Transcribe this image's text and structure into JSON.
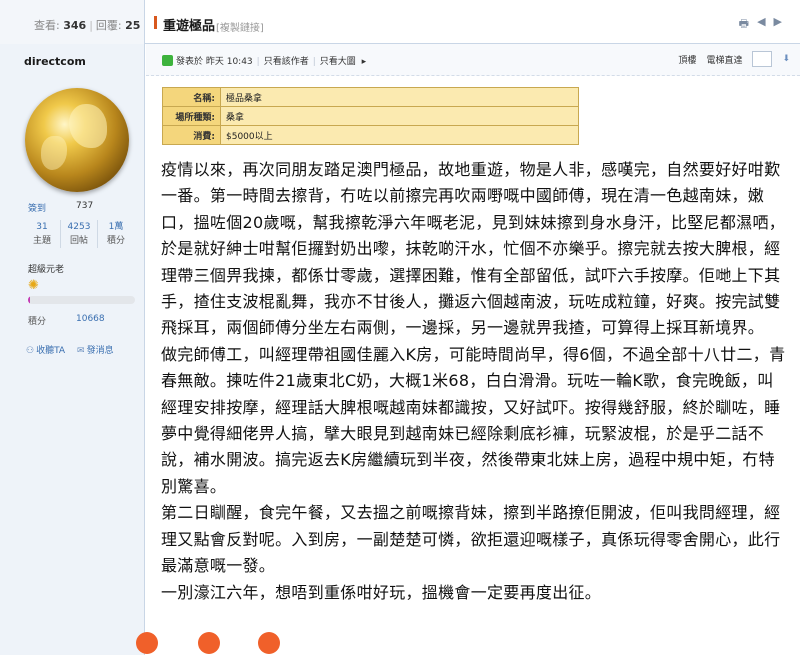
{
  "header": {
    "views_label": "查看:",
    "views": "346",
    "replies_label": "回覆:",
    "replies": "25",
    "title": "重遊極品",
    "copy_link": "[複製鏈接]",
    "icons": [
      "print-icon",
      "prev-arrow-icon",
      "next-arrow-icon"
    ]
  },
  "user": {
    "name": "directcom",
    "signin_label": "簽到",
    "signin_value": "737",
    "stats": [
      {
        "value": "31",
        "label": "主題"
      },
      {
        "value": "4253",
        "label": "回帖"
      },
      {
        "value": "1萬",
        "label": "積分"
      }
    ],
    "rank": "超級元老",
    "rank_progress": 0.02,
    "points_label": "積分",
    "points_value": "10668",
    "collect_label": "收聽TA",
    "message_label": "發消息"
  },
  "post_meta": {
    "posted": "發表於 昨天 10:43",
    "author_only": "只看該作者",
    "large_image": "只看大圖",
    "top_label": "頂樓",
    "goto_label": "電梯直達"
  },
  "info_table": [
    {
      "key": "名稱:",
      "value": "極品桑拿"
    },
    {
      "key": "場所種類:",
      "value": "桑拿"
    },
    {
      "key": "消費:",
      "value": "$5000以上"
    }
  ],
  "article": [
    "疫情以來，再次同朋友踏足澳門極品，故地重遊，物是人非，感嘆完，自然要好好咁歎一番。第一時間去擦背，冇咗以前擦完再吹兩嘢嘅中國師傅，現在清一色越南妹，嫩口，搵咗個20歲嘅，幫我擦乾淨六年嘅老泥，見到妹妹擦到身水身汗，比堅尼都濕哂，於是就好紳士咁幫佢攞對奶出嚟，抹乾啲汗水，忙個不亦樂乎。擦完就去按大脾根，經理帶三個畀我揀，都係廿零歲，選擇困難，惟有全部留低，試吓六手按摩。佢哋上下其手，揸住支波棍亂舞，我亦不甘後人，攤返六個越南波，玩咗成粒鐘，好爽。按完試雙飛採耳，兩個師傅分坐左右兩側，一邊採，另一邊就畀我揸，可算得上採耳新境界。",
    "做完師傅工，叫經理帶祖國佳麗入K房，可能時間尚早，得6個，不過全部十八廿二，青春無敵。揀咗件21歲東北C奶，大概1米68，白白滑滑。玩咗一輪K歌，食完晚飯，叫經理安排按摩，經理話大脾根嘅越南妹都識按，又好試吓。按得幾舒服，終於瞓咗，睡夢中覺得細佬畀人搞，擘大眼見到越南妹已經除剩底衫褲，玩緊波棍，於是乎二話不說，補水開波。搞完返去K房繼續玩到半夜，然後帶東北妹上房，過程中規中矩，冇特別驚喜。",
    "第二日瞓醒，食完午餐，又去搵之前嘅擦背妹，擦到半路撩佢開波，佢叫我問經理，經理又點會反對呢。入到房，一副楚楚可憐，欲拒還迎嘅樣子，真係玩得零舍開心，此行最滿意嘅一發。",
    "一別濠江六年，想唔到重係咁好玩，搵機會一定要再度出征。"
  ],
  "colors": {
    "accent": "#d8581e",
    "link": "#3a6fb0",
    "table_key": "#f4d67c",
    "table_value": "#fbeab0",
    "dot": "#f0602a"
  }
}
